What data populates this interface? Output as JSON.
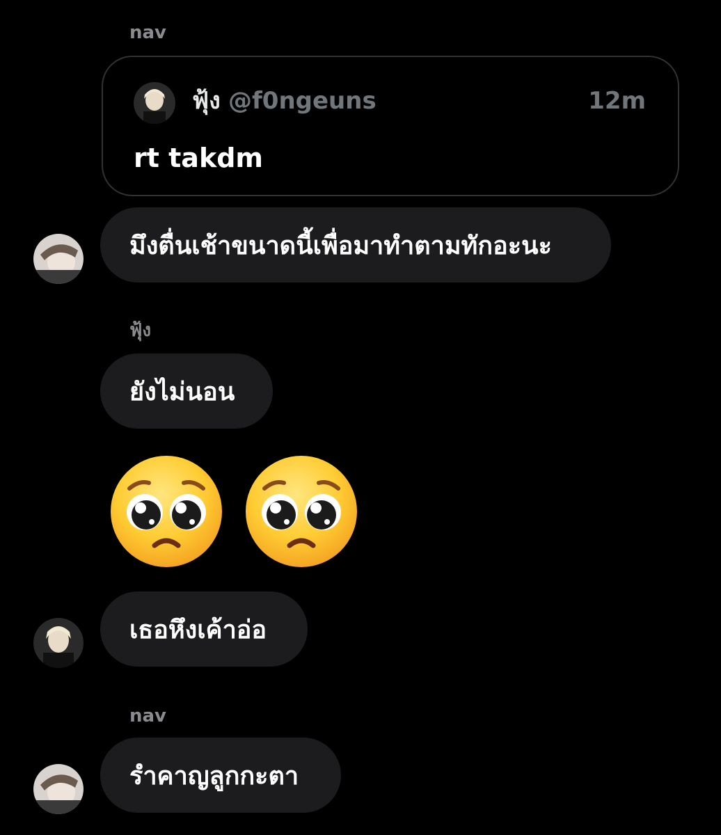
{
  "thread": {
    "header_sender": "nav",
    "quoted_post": {
      "author_name": "ฟุ้ง",
      "handle": "@f0ngeuns",
      "time": "12m",
      "text": "rt takdm"
    },
    "messages": [
      {
        "sender": "nav",
        "text": "มึงตื่นเช้าขนาดนี้เพื่อมาทำตามทักอะนะ"
      },
      {
        "sender_label": "ฟุ้ง",
        "text": "ยังไม่นอน"
      },
      {
        "emoji": [
          "pleading-face",
          "pleading-face"
        ]
      },
      {
        "text": "เธอหึงเค้าอ่อ"
      },
      {
        "sender_label": "nav",
        "text": "รำคาญลูกกะตา"
      }
    ]
  },
  "colors": {
    "background": "#000000",
    "bubble": "#1c1c1e",
    "card_border": "#2f3336",
    "muted_text": "#71767b",
    "sender_label": "#8b8b8f"
  }
}
